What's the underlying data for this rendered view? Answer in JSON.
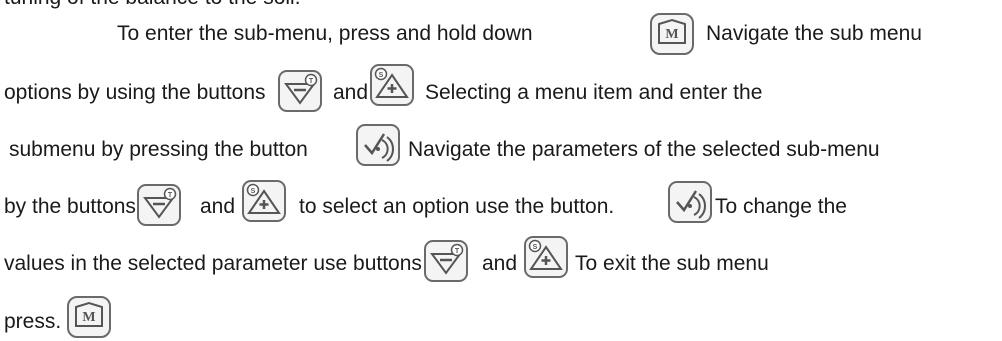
{
  "lines": {
    "l0": "tuning of the balance to the soil.",
    "l1a": "To enter the sub-menu, press and hold down",
    "l1b": "Navigate the sub menu",
    "l2a": "options by using the buttons",
    "l2b": "and",
    "l2c": "Selecting a menu item and enter the",
    "l3a": "submenu by pressing the button",
    "l3b": "Navigate  the parameters of the selected sub-menu",
    "l4a": "by the buttons",
    "l4b": "and",
    "l4c": "to select an option use the button.",
    "l4d": "To change the",
    "l5a": "values in the selected parameter use buttons",
    "l5b": "and",
    "l5c": "To exit the sub menu",
    "l6a": "press."
  },
  "icons": {
    "menu": "menu-m-button-icon",
    "minus": "minus-t-button-icon",
    "plus": "plus-s-button-icon",
    "ok": "check-target-button-icon",
    "badge_t": "T",
    "badge_s": "S"
  },
  "colors": {
    "text": "#1a1a1a",
    "icon": "#555555",
    "icon_bg": "#f4f4f4"
  }
}
